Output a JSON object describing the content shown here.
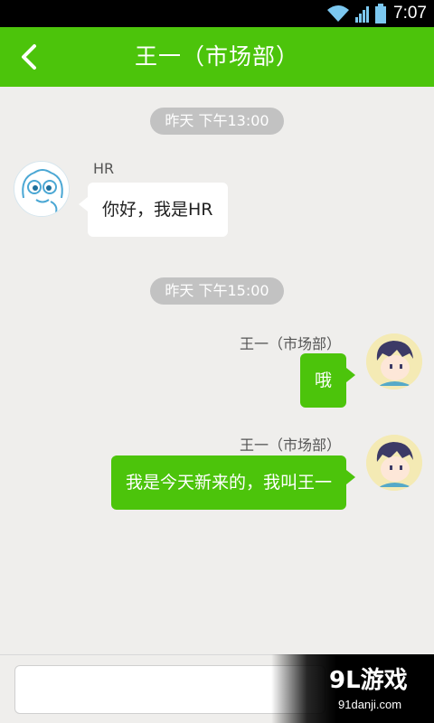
{
  "status_bar": {
    "time": "7:07",
    "icons": [
      "wifi-icon",
      "signal-icon",
      "battery-icon"
    ]
  },
  "header": {
    "title": "王一（市场部）",
    "back_icon": "chevron-left-icon"
  },
  "colors": {
    "accent": "#4cc40b",
    "chip": "#c2c2c2",
    "background": "#efeeec"
  },
  "chat": {
    "timestamps": [
      "昨天  下午13:00",
      "昨天  下午15:00"
    ],
    "messages": [
      {
        "direction": "incoming",
        "sender": "HR",
        "text": "你好，我是HR"
      },
      {
        "direction": "outgoing",
        "sender": "王一（市场部）",
        "text": "哦"
      },
      {
        "direction": "outgoing",
        "sender": "王一（市场部）",
        "text": "我是今天新来的，我叫王一"
      }
    ]
  },
  "input_bar": {
    "message_value": "",
    "send_label": ""
  },
  "watermark": {
    "logo": "9L游戏",
    "url": "91danji.com"
  }
}
